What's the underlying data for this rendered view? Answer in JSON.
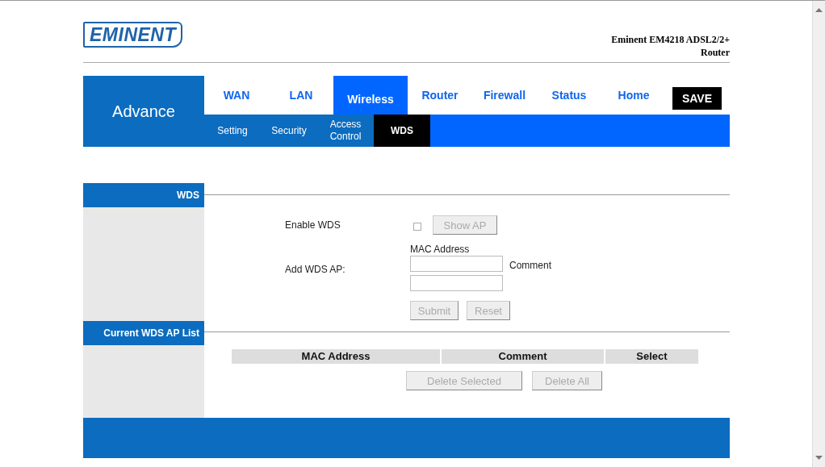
{
  "logo": "EMINENT",
  "product_title": [
    "Eminent EM4218 ADSL2/2+",
    "Router"
  ],
  "section": "Advance",
  "tabs": [
    {
      "label": "WAN",
      "selected": false
    },
    {
      "label": "LAN",
      "selected": false
    },
    {
      "label": "Wireless",
      "selected": true
    },
    {
      "label": "Router",
      "selected": false
    },
    {
      "label": "Firewall",
      "selected": false
    },
    {
      "label": "Status",
      "selected": false
    },
    {
      "label": "Home",
      "selected": false
    }
  ],
  "save_button": "SAVE",
  "subtabs": [
    {
      "label": "Setting",
      "selected": false
    },
    {
      "label": "Security",
      "selected": false
    },
    {
      "label": "Access Control",
      "selected": false
    },
    {
      "label": "WDS",
      "selected": true
    }
  ],
  "wds": {
    "heading": "WDS",
    "enable_label": "Enable WDS",
    "enable_checked": false,
    "show_ap_button": {
      "label": "Show AP",
      "disabled": true
    },
    "add_label": "Add WDS AP:",
    "mac_label": "MAC Address",
    "comment_label": "Comment",
    "submit_button": {
      "label": "Submit",
      "disabled": true
    },
    "reset_button": {
      "label": "Reset",
      "disabled": true
    }
  },
  "ap_list": {
    "heading": "Current WDS AP List",
    "columns": [
      "MAC Address",
      "Comment",
      "Select"
    ],
    "buttons": [
      {
        "label": "Delete Selected",
        "disabled": true
      },
      {
        "label": "Delete All",
        "disabled": true
      }
    ]
  }
}
